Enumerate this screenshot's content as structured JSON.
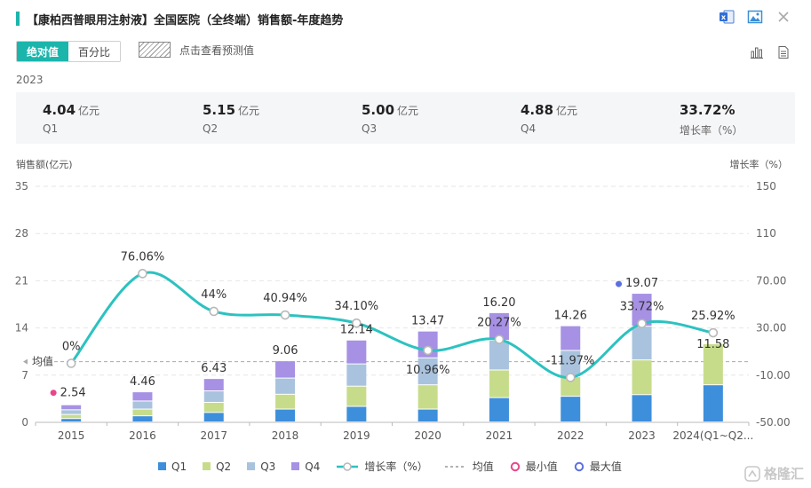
{
  "header": {
    "title": "【康柏西普眼用注射液】全国医院（全终端）销售额-年度趋势"
  },
  "toggle": {
    "absolute_label": "绝对值",
    "percent_label": "百分比"
  },
  "forecast": {
    "label": "点击查看预测值"
  },
  "summary": {
    "year": "2023",
    "items": [
      {
        "value": "4.04",
        "unit": "亿元",
        "name": "Q1"
      },
      {
        "value": "5.15",
        "unit": "亿元",
        "name": "Q2"
      },
      {
        "value": "5.00",
        "unit": "亿元",
        "name": "Q3"
      },
      {
        "value": "4.88",
        "unit": "亿元",
        "name": "Q4"
      },
      {
        "value": "33.72%",
        "unit": "",
        "name": "增长率（%）"
      }
    ]
  },
  "watermark": {
    "text": "格隆汇"
  },
  "chart_data": {
    "type": "bar",
    "stacked": true,
    "categories": [
      "2015",
      "2016",
      "2017",
      "2018",
      "2019",
      "2020",
      "2021",
      "2022",
      "2023",
      "2024(Q1~Q2..."
    ],
    "left_axis": {
      "label": "销售额(亿元)",
      "ticks": [
        "0",
        "7",
        "14",
        "21",
        "28",
        "35"
      ],
      "range": [
        0,
        35
      ]
    },
    "right_axis": {
      "label": "增长率（%）",
      "ticks": [
        "-50.00",
        "-10.00",
        "30.00",
        "70.00",
        "110",
        "150"
      ],
      "range": [
        -50,
        150
      ]
    },
    "series": [
      {
        "name": "Q1",
        "color": "#3d8fdb",
        "values": [
          0.5,
          0.9,
          1.4,
          1.9,
          2.3,
          1.9,
          3.6,
          3.8,
          4.04,
          5.5
        ]
      },
      {
        "name": "Q2",
        "color": "#c7dc8b",
        "values": [
          0.6,
          1.0,
          1.5,
          2.2,
          3.0,
          3.6,
          4.1,
          2.9,
          5.15,
          6.08
        ]
      },
      {
        "name": "Q3",
        "color": "#a9c3de",
        "values": [
          0.7,
          1.2,
          1.7,
          2.4,
          3.3,
          4.0,
          4.4,
          3.9,
          5.0,
          0
        ]
      },
      {
        "name": "Q4",
        "color": "#a691e4",
        "values": [
          0.74,
          1.36,
          1.83,
          2.56,
          3.54,
          3.97,
          4.1,
          3.66,
          4.88,
          0
        ]
      }
    ],
    "totals": [
      2.54,
      4.46,
      6.43,
      9.06,
      12.14,
      13.47,
      16.2,
      14.26,
      19.07,
      11.58
    ],
    "total_labels": [
      "2.54",
      "4.46",
      "6.43",
      "9.06",
      "12.14",
      "13.47",
      "16.20",
      "14.26",
      "19.07",
      "11.58"
    ],
    "growth": {
      "name": "增长率（%）",
      "color": "#2cc2c0",
      "values": [
        0,
        76.06,
        44,
        40.94,
        34.1,
        10.96,
        20.27,
        -11.97,
        33.72,
        25.92
      ],
      "labels": [
        "0%",
        "76.06%",
        "44%",
        "40.94%",
        "34.10%",
        "10.96%",
        "20.27%",
        "-11.97%",
        "33.72%",
        "25.92%"
      ]
    },
    "average": {
      "label": "均值",
      "value": 9.0
    },
    "min_marker": {
      "index": 0,
      "color": "#e8468a"
    },
    "max_marker": {
      "index": 8,
      "color": "#5b6fe0"
    },
    "legend": [
      {
        "name": "Q1",
        "kind": "square",
        "color": "#3d8fdb"
      },
      {
        "name": "Q2",
        "kind": "square",
        "color": "#c7dc8b"
      },
      {
        "name": "Q3",
        "kind": "square",
        "color": "#a9c3de"
      },
      {
        "name": "Q4",
        "kind": "square",
        "color": "#a691e4"
      },
      {
        "name": "增长率（%）",
        "kind": "line",
        "color": "#2cc2c0"
      },
      {
        "name": "均值",
        "kind": "dash",
        "color": "#999999"
      },
      {
        "name": "最小值",
        "kind": "circle",
        "color": "#e8468a"
      },
      {
        "name": "最大值",
        "kind": "circle",
        "color": "#5b6fe0"
      }
    ]
  }
}
